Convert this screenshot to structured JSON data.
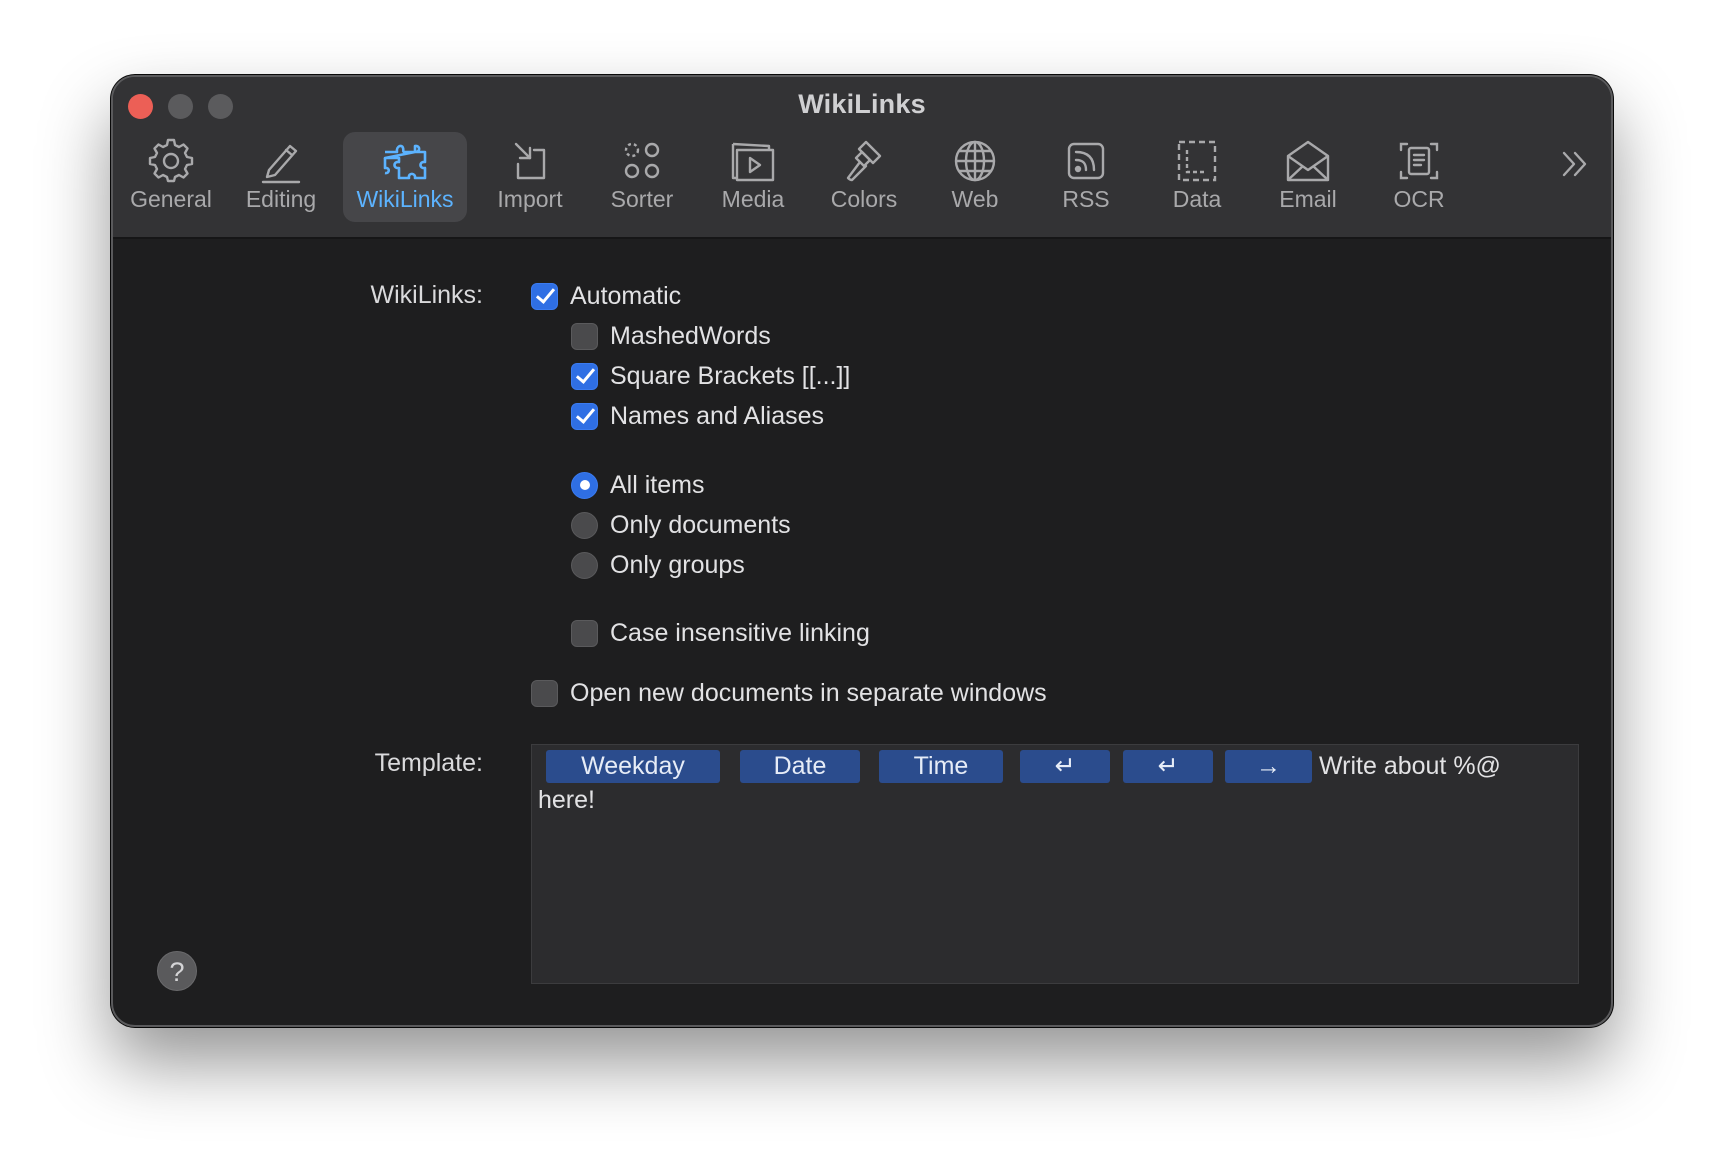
{
  "window": {
    "title": "WikiLinks"
  },
  "toolbar": {
    "items": [
      {
        "label": "General",
        "icon": "gear-icon",
        "active": false
      },
      {
        "label": "Editing",
        "icon": "pencil-icon",
        "active": false
      },
      {
        "label": "WikiLinks",
        "icon": "puzzle-icon",
        "active": true
      },
      {
        "label": "Import",
        "icon": "import-arrow-icon",
        "active": false
      },
      {
        "label": "Sorter",
        "icon": "sorter-circles-icon",
        "active": false
      },
      {
        "label": "Media",
        "icon": "media-play-icon",
        "active": false
      },
      {
        "label": "Colors",
        "icon": "paintbrush-icon",
        "active": false
      },
      {
        "label": "Web",
        "icon": "globe-icon",
        "active": false
      },
      {
        "label": "RSS",
        "icon": "rss-icon",
        "active": false
      },
      {
        "label": "Data",
        "icon": "dashed-square-icon",
        "active": false
      },
      {
        "label": "Email",
        "icon": "envelope-icon",
        "active": false
      },
      {
        "label": "OCR",
        "icon": "ocr-document-icon",
        "active": false
      }
    ],
    "more_icon": "chevron-double-right-icon"
  },
  "wikilinks": {
    "label": "WikiLinks:",
    "automatic": {
      "label": "Automatic",
      "checked": true
    },
    "mashed_words": {
      "label": "MashedWords",
      "checked": false
    },
    "square_brackets": {
      "label": "Square Brackets [[...]]",
      "checked": true
    },
    "names_aliases": {
      "label": "Names and Aliases",
      "checked": true
    },
    "scope": {
      "options": [
        "All items",
        "Only documents",
        "Only groups"
      ],
      "selected": "All items"
    },
    "case_insensitive": {
      "label": "Case insensitive linking",
      "checked": false
    },
    "open_new_windows": {
      "label": "Open new documents in separate windows",
      "checked": false
    }
  },
  "template": {
    "label": "Template:",
    "tokens": [
      "Weekday",
      "Date",
      "Time",
      "↵",
      "↵",
      "→"
    ],
    "text_line1": "Write about %@",
    "text_line2": "here!"
  },
  "help": {
    "label": "?"
  },
  "colors": {
    "accent": "#2f6fe4",
    "active_tab_text": "#5cb3ff",
    "token_bg": "#2b4c8d",
    "close_button": "#ec5f56"
  }
}
